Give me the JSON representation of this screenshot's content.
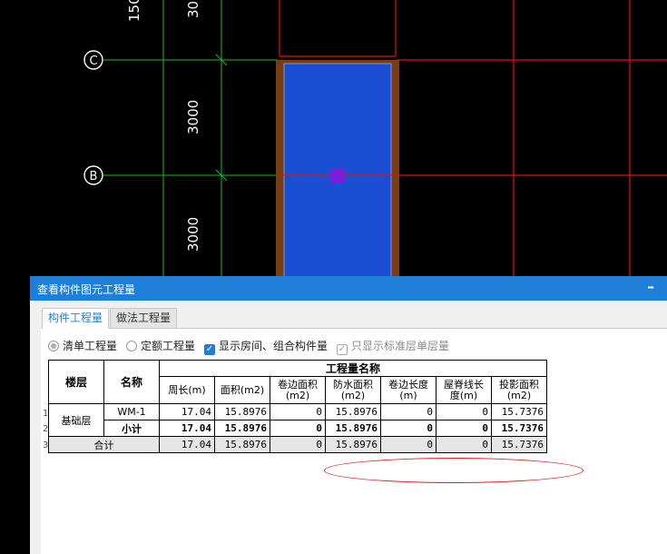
{
  "cad": {
    "axes": [
      {
        "label": "C",
        "name": "axis-c"
      },
      {
        "label": "B",
        "name": "axis-b"
      }
    ],
    "dimensions": [
      "150",
      "30",
      "3000",
      "3000"
    ]
  },
  "window": {
    "title": "查看构件图元工程量",
    "minimize": "–"
  },
  "tabs": [
    {
      "label": "构件工程量",
      "active": true
    },
    {
      "label": "做法工程量",
      "active": false
    }
  ],
  "options": {
    "radio_list": "清单工程量",
    "radio_quota": "定额工程量",
    "show_rooms": "显示房间、组合构件量",
    "standard_floor": "只显示标准层单层量"
  },
  "table": {
    "header_floor": "楼层",
    "header_name": "名称",
    "header_group": "工程量名称",
    "columns": [
      "周长(m)",
      "面积(m2)",
      "卷边面积(m2)",
      "防水面积(m2)",
      "卷边长度(m)",
      "屋脊线长度(m)",
      "投影面积(m2)"
    ],
    "floor": "基础层",
    "row_numbers": [
      "1",
      "2",
      "3"
    ],
    "rows": [
      {
        "name": "WM-1",
        "values": [
          "17.04",
          "15.8976",
          "0",
          "15.8976",
          "0",
          "0",
          "15.7376"
        ]
      },
      {
        "name": "小计",
        "values": [
          "17.04",
          "15.8976",
          "0",
          "15.8976",
          "0",
          "0",
          "15.7376"
        ]
      }
    ],
    "total": {
      "label": "合计",
      "values": [
        "17.04",
        "15.8976",
        "0",
        "15.8976",
        "0",
        "0",
        "15.7376"
      ]
    }
  },
  "colors": {
    "titlebar": "#1f7fd8",
    "member_fill": "#1a4fd4",
    "member_border": "#7a3d12",
    "grid_red": "#e01010",
    "grid_green": "#1dbb1d",
    "highlight": "#e02020"
  }
}
